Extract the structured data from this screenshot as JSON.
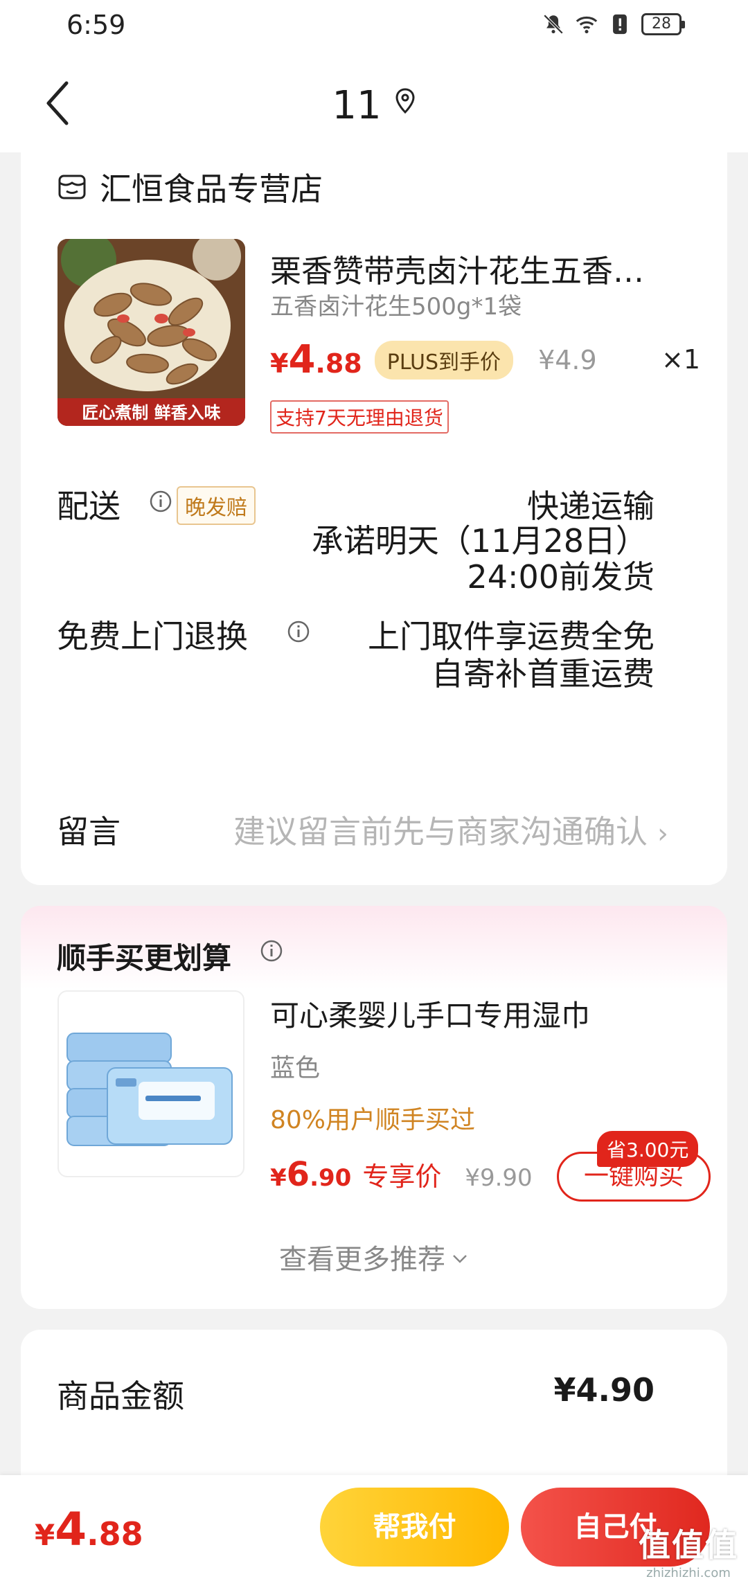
{
  "status_bar": {
    "time": "6:59",
    "battery": "28"
  },
  "nav": {
    "title": "11"
  },
  "store": {
    "name": "汇恒食品专营店"
  },
  "product": {
    "name": "栗香赞带壳卤汁花生五香…",
    "spec": "五香卤汁花生500g*1袋",
    "price_yen": "¥",
    "price_int": "4",
    "price_dec": ".88",
    "plus_tag": "PLUS到手价",
    "original_price": "¥4.9",
    "quantity": "×1",
    "return_tag": "支持7天无理由退货",
    "image_caption": "匠心煮制 鲜香入味"
  },
  "delivery": {
    "label": "配送",
    "late_tag": "晚发赔",
    "method": "快递运输",
    "promise_line1": "承诺明天（11月28日）",
    "promise_line2": "24:00前发货"
  },
  "free_return": {
    "label": "免费上门退换",
    "line1": "上门取件享运费全免",
    "line2": "自寄补首重运费"
  },
  "message": {
    "label": "留言",
    "placeholder": "建议留言前先与商家沟通确认"
  },
  "addon": {
    "title": "顺手买更划算",
    "name": "可心柔婴儿手口专用湿巾",
    "color": "蓝色",
    "bought": "80%用户顺手买过",
    "price_yen": "¥",
    "price_int": "6",
    "price_dec": ".90",
    "exclusive_label": "专享价",
    "original_price": "¥9.90",
    "save_tag": "省3.00元",
    "buy_button": "一键购买",
    "more": "查看更多推荐"
  },
  "summary": {
    "goods_amount_label": "商品金额",
    "goods_amount_value": "¥4.90"
  },
  "bottom": {
    "total_yen": "¥",
    "total_int": "4",
    "total_dec": ".88",
    "help_pay": "帮我付",
    "self_pay": "自己付"
  },
  "watermark": {
    "main": "值值值",
    "url": "zhizhizhi.com"
  },
  "colors": {
    "accent": "#e1251b",
    "gold": "#ffb800",
    "plus": "#fbe4ad"
  }
}
